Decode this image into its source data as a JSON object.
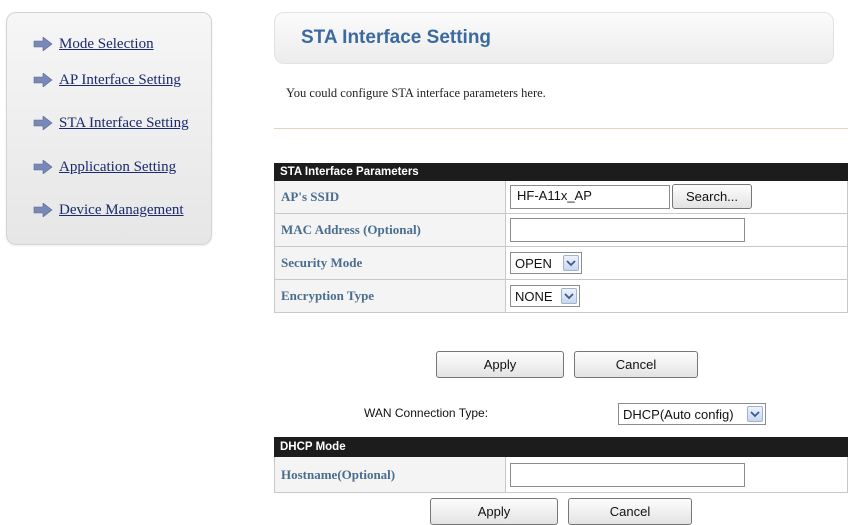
{
  "sidebar": {
    "items": [
      {
        "label": "Mode Selection"
      },
      {
        "label": "AP Interface Setting"
      },
      {
        "label": "STA Interface Setting"
      },
      {
        "label": "Application Setting"
      },
      {
        "label": "Device Management"
      }
    ]
  },
  "header": {
    "title": "STA Interface Setting",
    "description": "You could configure STA interface parameters here."
  },
  "sta_params": {
    "section_title": "STA Interface Parameters",
    "ssid_label": "AP's SSID",
    "ssid_value": "HF-A11x_AP",
    "search_label": "Search...",
    "mac_label": "MAC Address (Optional)",
    "mac_value": "",
    "security_label": "Security Mode",
    "security_value": "OPEN",
    "encryption_label": "Encryption Type",
    "encryption_value": "NONE",
    "apply_label": "Apply",
    "cancel_label": "Cancel"
  },
  "wan": {
    "label": "WAN Connection Type:",
    "value": "DHCP(Auto config)"
  },
  "dhcp": {
    "section_title": "DHCP Mode",
    "hostname_label": "Hostname(Optional)",
    "hostname_value": "",
    "apply_label": "Apply",
    "cancel_label": "Cancel"
  },
  "icons": {
    "nav_arrow": "arrow-right-icon",
    "dropdown": "chevron-down-icon"
  },
  "colors": {
    "nav_link": "#1a2a6c",
    "title": "#3b6aa0",
    "label": "#4a6d8f",
    "arrow": "#7a88b8",
    "section_header": "#1c1c1c"
  }
}
